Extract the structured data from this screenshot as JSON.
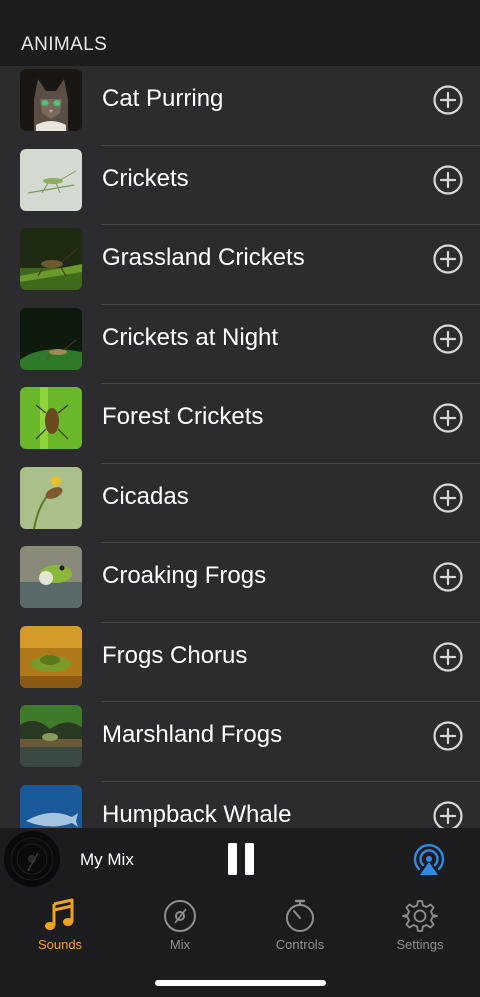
{
  "section": {
    "title": "ANIMALS"
  },
  "sounds": [
    {
      "label": "Cat Purring",
      "thumb": "cat"
    },
    {
      "label": "Crickets",
      "thumb": "cricket-light"
    },
    {
      "label": "Grassland Crickets",
      "thumb": "cricket-grass"
    },
    {
      "label": "Crickets at Night",
      "thumb": "cricket-night"
    },
    {
      "label": "Forest Crickets",
      "thumb": "cricket-forest"
    },
    {
      "label": "Cicadas",
      "thumb": "cicada"
    },
    {
      "label": "Croaking Frogs",
      "thumb": "frog-croak"
    },
    {
      "label": "Frogs Chorus",
      "thumb": "frog-chorus"
    },
    {
      "label": "Marshland Frogs",
      "thumb": "frog-marsh"
    },
    {
      "label": "Humpback Whale",
      "thumb": "whale"
    }
  ],
  "player": {
    "mix_name": "My Mix",
    "state": "playing"
  },
  "tabs": [
    {
      "label": "Sounds",
      "icon": "music-note-icon",
      "active": true
    },
    {
      "label": "Mix",
      "icon": "disc-icon",
      "active": false
    },
    {
      "label": "Controls",
      "icon": "stopwatch-icon",
      "active": false
    },
    {
      "label": "Settings",
      "icon": "gear-icon",
      "active": false
    }
  ],
  "colors": {
    "accent": "#f0a31b",
    "airplay": "#2f8ae4",
    "background": "#1c1c1e",
    "list_background": "#2c2c2e",
    "inactive": "#8e8e93"
  }
}
